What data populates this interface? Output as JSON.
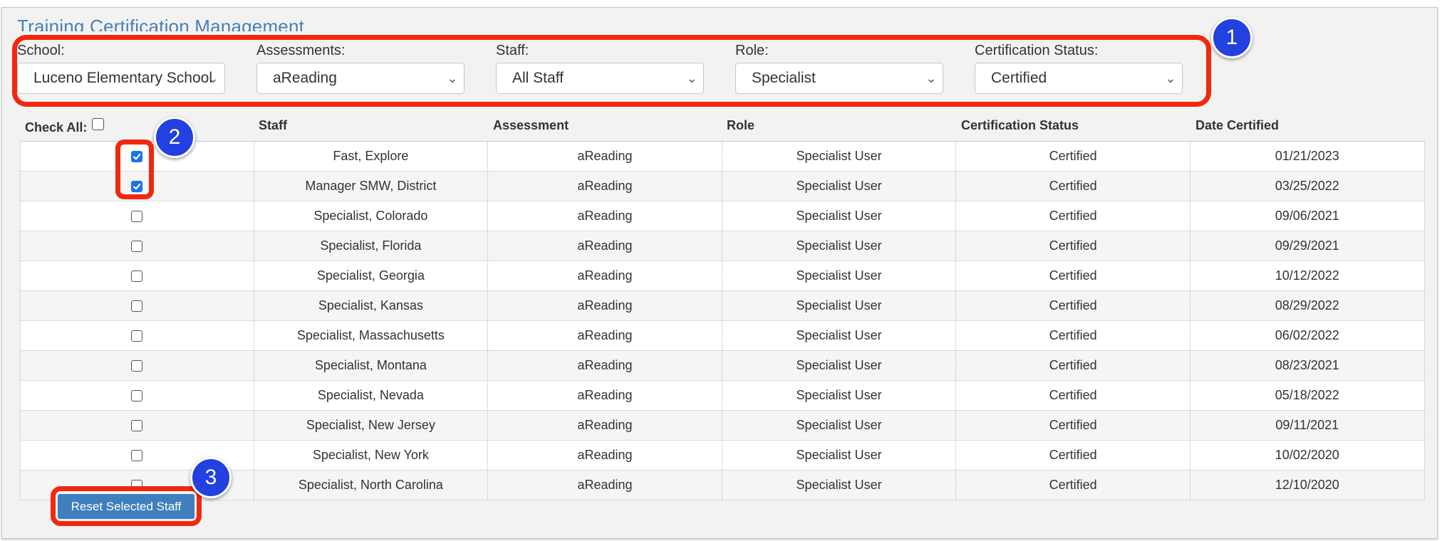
{
  "page": {
    "title": "Training Certification Management"
  },
  "filters": [
    {
      "label": "School:",
      "value": "Luceno Elementary School"
    },
    {
      "label": "Assessments:",
      "value": "aReading"
    },
    {
      "label": "Staff:",
      "value": "All Staff"
    },
    {
      "label": "Role:",
      "value": "Specialist"
    },
    {
      "label": "Certification Status:",
      "value": "Certified"
    }
  ],
  "table": {
    "check_all_label": "Check All:",
    "columns": [
      "Staff",
      "Assessment",
      "Role",
      "Certification Status",
      "Date Certified"
    ],
    "rows": [
      {
        "checked": true,
        "staff": "Fast, Explore",
        "assessment": "aReading",
        "role": "Specialist User",
        "status": "Certified",
        "date": "01/21/2023"
      },
      {
        "checked": true,
        "staff": "Manager SMW, District",
        "assessment": "aReading",
        "role": "Specialist User",
        "status": "Certified",
        "date": "03/25/2022"
      },
      {
        "checked": false,
        "staff": "Specialist, Colorado",
        "assessment": "aReading",
        "role": "Specialist User",
        "status": "Certified",
        "date": "09/06/2021"
      },
      {
        "checked": false,
        "staff": "Specialist, Florida",
        "assessment": "aReading",
        "role": "Specialist User",
        "status": "Certified",
        "date": "09/29/2021"
      },
      {
        "checked": false,
        "staff": "Specialist, Georgia",
        "assessment": "aReading",
        "role": "Specialist User",
        "status": "Certified",
        "date": "10/12/2022"
      },
      {
        "checked": false,
        "staff": "Specialist, Kansas",
        "assessment": "aReading",
        "role": "Specialist User",
        "status": "Certified",
        "date": "08/29/2022"
      },
      {
        "checked": false,
        "staff": "Specialist, Massachusetts",
        "assessment": "aReading",
        "role": "Specialist User",
        "status": "Certified",
        "date": "06/02/2022"
      },
      {
        "checked": false,
        "staff": "Specialist, Montana",
        "assessment": "aReading",
        "role": "Specialist User",
        "status": "Certified",
        "date": "08/23/2021"
      },
      {
        "checked": false,
        "staff": "Specialist, Nevada",
        "assessment": "aReading",
        "role": "Specialist User",
        "status": "Certified",
        "date": "05/18/2022"
      },
      {
        "checked": false,
        "staff": "Specialist, New Jersey",
        "assessment": "aReading",
        "role": "Specialist User",
        "status": "Certified",
        "date": "09/11/2021"
      },
      {
        "checked": false,
        "staff": "Specialist, New York",
        "assessment": "aReading",
        "role": "Specialist User",
        "status": "Certified",
        "date": "10/02/2020"
      },
      {
        "checked": false,
        "staff": "Specialist, North Carolina",
        "assessment": "aReading",
        "role": "Specialist User",
        "status": "Certified",
        "date": "12/10/2020"
      }
    ]
  },
  "actions": {
    "reset_label": "Reset Selected Staff"
  },
  "callouts": [
    "1",
    "2",
    "3"
  ],
  "colors": {
    "accent": "#3f7fbd",
    "highlight": "#f2280e",
    "badge": "#2340e0",
    "title": "#4a7fb3"
  }
}
